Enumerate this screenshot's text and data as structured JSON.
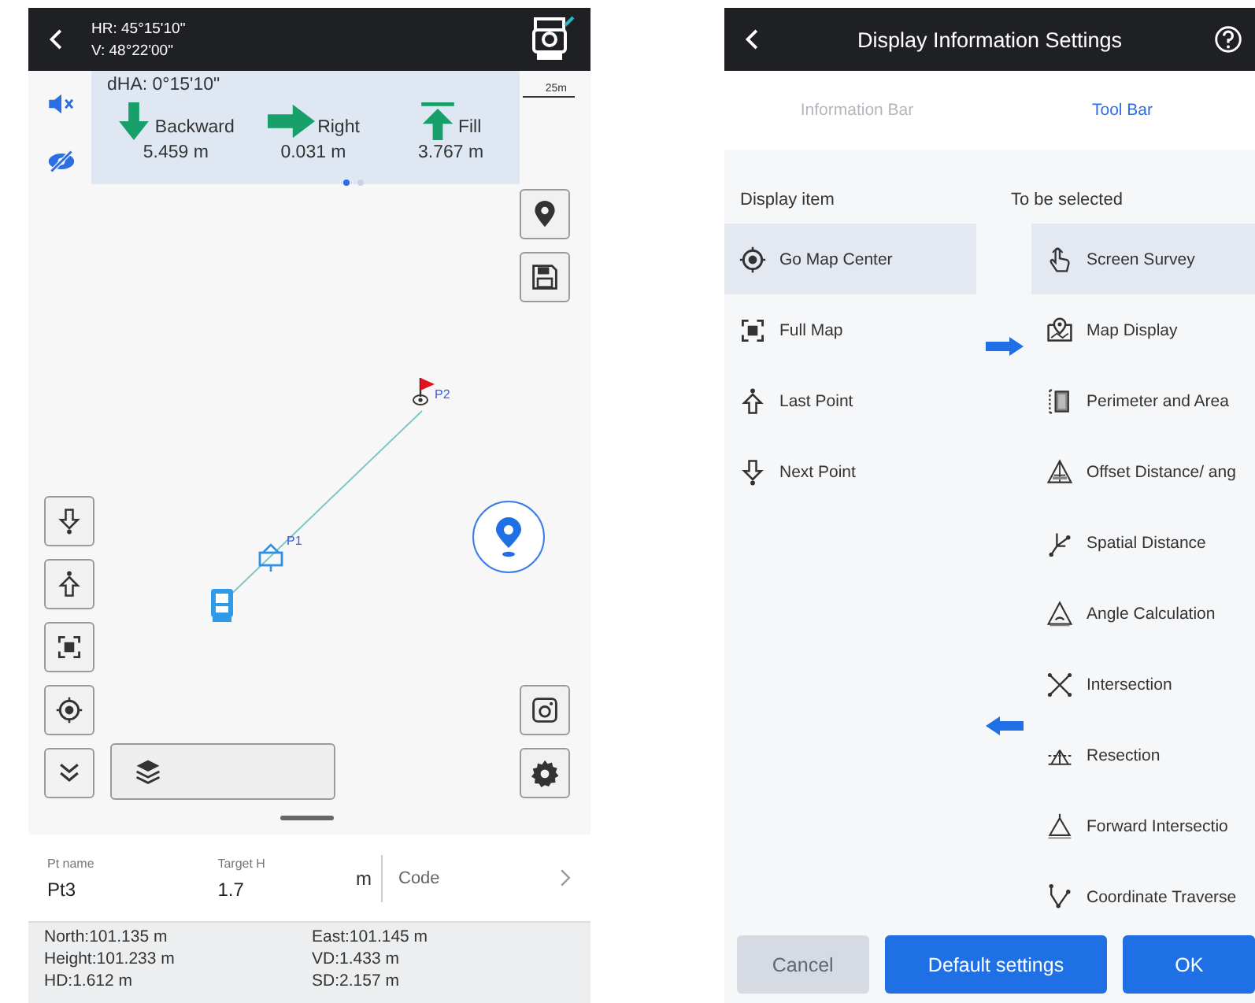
{
  "survey_screen": {
    "header": {
      "hr": "HR: 45°15'10\"",
      "v": "V: 48°22'00\""
    },
    "scale": "25m",
    "stakeout": {
      "dha": "dHA: 0°15'10\"",
      "directions": [
        {
          "kind": "down",
          "label": "Backward",
          "value": "5.459 m"
        },
        {
          "kind": "right",
          "label": "Right",
          "value": "0.031 m"
        },
        {
          "kind": "fill",
          "label": "Fill",
          "value": "3.767 m"
        }
      ],
      "pages": [
        {
          "selected": true
        },
        {
          "selected": false
        }
      ]
    },
    "map_points": [
      {
        "kind": "target",
        "label": "P2"
      },
      {
        "kind": "station",
        "label": "P1"
      }
    ],
    "inputs": [
      {
        "label": "Pt name",
        "value": "Pt3"
      },
      {
        "label": "Target H",
        "value": "1.7",
        "unit": "m"
      },
      {
        "placeholder": "Code"
      }
    ],
    "readings": [
      "North:101.135 m",
      "East:101.145 m",
      "Height:101.233 m",
      "VD:1.433 m",
      "HD:1.612 m",
      "SD:2.157 m"
    ]
  },
  "settings_screen": {
    "title": "Display Information Settings",
    "tabs": [
      {
        "label": "Information Bar",
        "selected": false
      },
      {
        "label": "Tool Bar",
        "selected": true
      }
    ],
    "display_heading": "Display item",
    "selectable_heading": "To be selected",
    "display_items": [
      {
        "label": "Go Map Center",
        "selected": true
      },
      {
        "label": "Full Map",
        "selected": false
      },
      {
        "label": "Last Point",
        "selected": false
      },
      {
        "label": "Next Point",
        "selected": false
      }
    ],
    "selectable_items": [
      {
        "label": "Screen Survey",
        "selected": true
      },
      {
        "label": "Map Display",
        "selected": false
      },
      {
        "label": "Perimeter and Area",
        "selected": false
      },
      {
        "label": "Offset Distance/ ang",
        "selected": false
      },
      {
        "label": "Spatial Distance",
        "selected": false
      },
      {
        "label": "Angle Calculation",
        "selected": false
      },
      {
        "label": "Intersection",
        "selected": false
      },
      {
        "label": "Resection",
        "selected": false
      },
      {
        "label": "Forward Intersectio",
        "selected": false
      },
      {
        "label": "Coordinate Traverse",
        "selected": false
      }
    ],
    "buttons": [
      {
        "label": "Cancel",
        "kind": "secondary",
        "disabled": true
      },
      {
        "label": "Default settings",
        "kind": "primary",
        "disabled": false
      },
      {
        "label": "OK",
        "kind": "primary",
        "disabled": false
      }
    ]
  }
}
